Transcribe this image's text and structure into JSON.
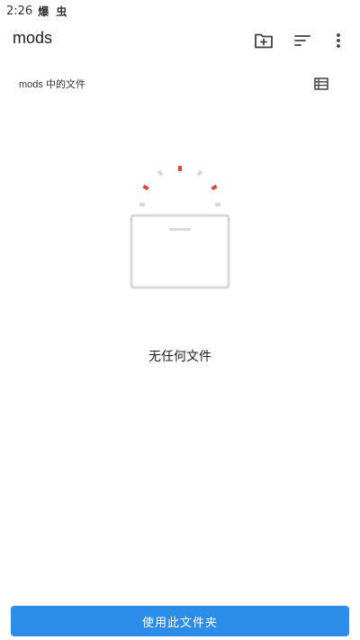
{
  "status_bar": {
    "time": "2:26",
    "app_glyphs": "爆 虫"
  },
  "app_bar": {
    "title": "mods",
    "icons": [
      "new-folder-icon",
      "sort-icon",
      "more-vert-icon"
    ]
  },
  "path_row": {
    "label": "mods 中的文件",
    "view_icon": "list-view-icon"
  },
  "empty_state": {
    "message": "无任何文件",
    "accent_color": "#e0463e",
    "muted_color": "#d9d9d9"
  },
  "footer": {
    "button_label": "使用此文件夹",
    "button_color": "#2b8de8"
  }
}
